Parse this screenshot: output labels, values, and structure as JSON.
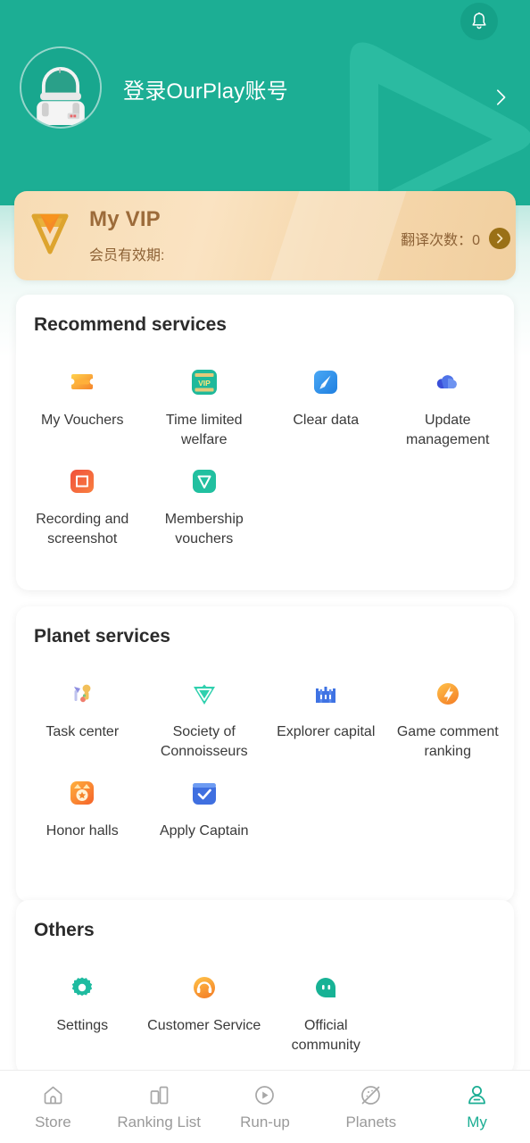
{
  "theme": {
    "brand": "#1CAE94",
    "header_bg": "#1CAE94",
    "vip_gold": "#9c6b3a",
    "nav_active": "#1CAE94",
    "nav_inactive": "#9a9a9a",
    "card_bg": "#FFFFFF"
  },
  "header": {
    "login_title": "登录OurPlay账号",
    "bell_icon": "bell-icon",
    "avatar_icon": "astronaut-avatar-icon",
    "chevron_icon": "chevron-right-icon",
    "watermark_icon": "play-triangle-watermark-icon"
  },
  "vip": {
    "badge_icon": "vip-v-badge-icon",
    "title": "My VIP",
    "subtitle": "会员有效期:",
    "translate_count_label": "翻译次数：0",
    "go_icon": "chevron-right-circle-icon"
  },
  "sections": [
    {
      "id": "recommend",
      "title": "Recommend services",
      "items": [
        {
          "label": "My Vouchers",
          "icon": "voucher-ticket-icon"
        },
        {
          "label": "Time limited welfare",
          "icon": "vip-card-welfare-icon"
        },
        {
          "label": "Clear data",
          "icon": "broom-clear-data-icon"
        },
        {
          "label": "Update management",
          "icon": "cloud-update-icon"
        },
        {
          "label": "Recording and screenshot",
          "icon": "screen-record-icon"
        },
        {
          "label": "Membership vouchers",
          "icon": "membership-v-icon"
        }
      ]
    },
    {
      "id": "planet",
      "title": "Planet services",
      "items": [
        {
          "label": "Task center",
          "icon": "task-center-icon"
        },
        {
          "label": "Society of Connoisseurs",
          "icon": "connoisseur-triangle-icon"
        },
        {
          "label": "Explorer capital",
          "icon": "castle-explorer-icon"
        },
        {
          "label": "Game comment ranking",
          "icon": "comment-ranking-icon"
        },
        {
          "label": "Honor halls",
          "icon": "honor-medal-icon"
        },
        {
          "label": "Apply Captain",
          "icon": "apply-captain-check-icon"
        }
      ]
    },
    {
      "id": "others",
      "title": "Others",
      "items": [
        {
          "label": "Settings",
          "icon": "gear-icon"
        },
        {
          "label": "Customer Service",
          "icon": "headset-support-icon"
        },
        {
          "label": "Official community",
          "icon": "community-chat-icon"
        }
      ]
    }
  ],
  "bottom_nav": {
    "active_index": 4,
    "items": [
      {
        "label": "Store",
        "icon": "home-icon"
      },
      {
        "label": "Ranking List",
        "icon": "bar-chart-icon"
      },
      {
        "label": "Run-up",
        "icon": "play-circle-icon"
      },
      {
        "label": "Planets",
        "icon": "planet-icon"
      },
      {
        "label": "My",
        "icon": "person-icon"
      }
    ]
  }
}
